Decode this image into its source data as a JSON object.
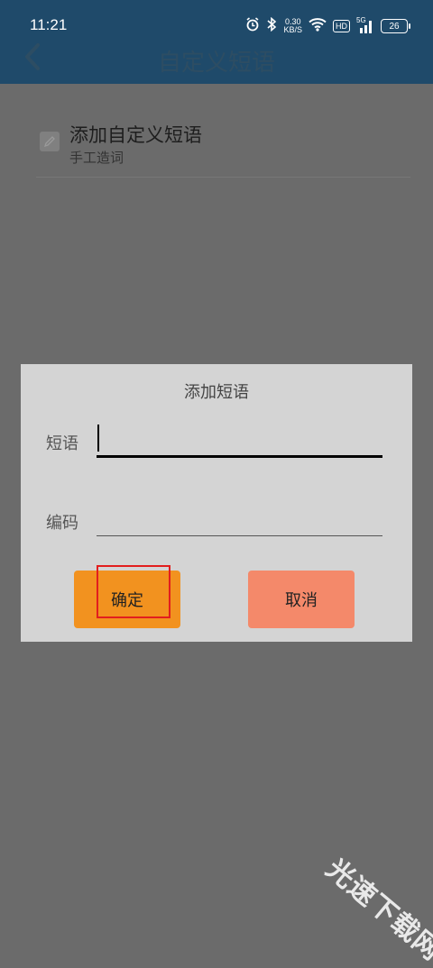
{
  "status_bar": {
    "time": "11:21",
    "net_speed_value": "0.30",
    "net_speed_unit": "KB/S",
    "hd_label": "HD",
    "signal_label": "5G",
    "battery": "26"
  },
  "app_bar": {
    "title": "自定义短语",
    "back_icon": "chevron-left-icon"
  },
  "list": {
    "items": [
      {
        "title": "添加自定义短语",
        "subtitle": "手工造词",
        "icon": "edit-icon"
      }
    ]
  },
  "dialog": {
    "title": "添加短语",
    "phrase_label": "短语",
    "phrase_value": "",
    "code_label": "编码",
    "code_value": "",
    "confirm_label": "确定",
    "cancel_label": "取消"
  },
  "watermark": "光速下载网",
  "colors": {
    "header": "#1f4a6a",
    "overlay": "#6b6b6b",
    "dialog_bg": "#d4d4d4",
    "confirm_button": "#f2921f",
    "cancel_button": "#f4896a",
    "highlight": "#e21e1e"
  }
}
